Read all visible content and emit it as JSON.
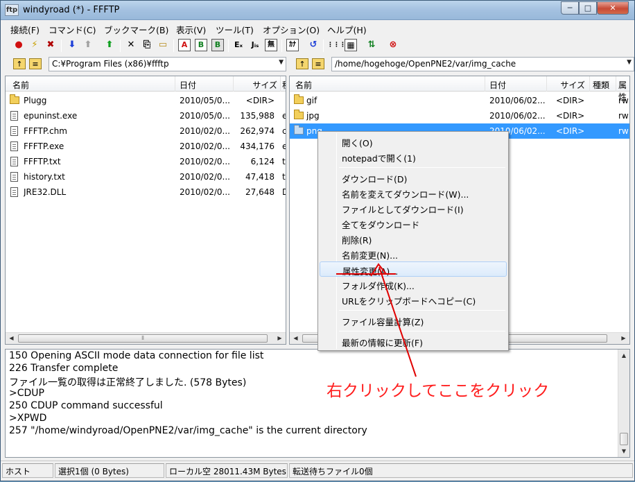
{
  "window": {
    "title": "windyroad (*) - FFFTP",
    "app_icon_label": "ftp",
    "min_label": "─",
    "max_label": "□",
    "close_label": "✕"
  },
  "menu": [
    "接続(F)",
    "コマンド(C)",
    "ブックマーク(B)",
    "表示(V)",
    "ツール(T)",
    "オプション(O)",
    "ヘルプ(H)"
  ],
  "toolbar": {
    "connect": "●",
    "quick_connect": "⚡",
    "disconnect": "✖",
    "download": "⬇",
    "upload": "⬆",
    "mirror_upload": "⬆",
    "delete": "✕",
    "rename": "⎘",
    "mkdir": "▭",
    "mode_ascii": "A",
    "mode_binary": "B",
    "mode_auto": "B",
    "kanji_euc": "Eₓ",
    "kanji_jis": "Jᵢₛ",
    "kanji_none": "無",
    "kana": "ｶﾅ",
    "refresh": "↺",
    "view_list": "⋮⋮⋮",
    "view_detail": "▦",
    "sync": "⇅",
    "stop": "⊗"
  },
  "local": {
    "path": "C:¥Program Files (x86)¥ffftp",
    "columns": [
      "名前",
      "日付",
      "サイズ",
      "種"
    ],
    "rows": [
      {
        "type": "folder",
        "name": "Plugg",
        "date": "2010/05/0...",
        "size": "<DIR>",
        "ext": ""
      },
      {
        "type": "file",
        "name": "epuninst.exe",
        "date": "2010/05/0...",
        "size": "135,988",
        "ext": "e"
      },
      {
        "type": "file",
        "name": "FFFTP.chm",
        "date": "2010/02/0...",
        "size": "262,974",
        "ext": "c"
      },
      {
        "type": "file",
        "name": "FFFTP.exe",
        "date": "2010/02/0...",
        "size": "434,176",
        "ext": "e"
      },
      {
        "type": "file",
        "name": "FFFTP.txt",
        "date": "2010/02/0...",
        "size": "6,124",
        "ext": "t"
      },
      {
        "type": "file",
        "name": "history.txt",
        "date": "2010/02/0...",
        "size": "47,418",
        "ext": "t"
      },
      {
        "type": "file",
        "name": "JRE32.DLL",
        "date": "2010/02/0...",
        "size": "27,648",
        "ext": "D"
      }
    ]
  },
  "remote": {
    "path": "/home/hogehoge/OpenPNE2/var/img_cache",
    "columns": [
      "名前",
      "日付",
      "サイズ",
      "種類",
      "属性"
    ],
    "rows": [
      {
        "type": "folder",
        "name": "gif",
        "date": "2010/06/02...",
        "size": "<DIR>",
        "kind": "",
        "attr": "rw"
      },
      {
        "type": "folder",
        "name": "jpg",
        "date": "2010/06/02...",
        "size": "<DIR>",
        "kind": "",
        "attr": "rw"
      },
      {
        "type": "folder",
        "name": "png",
        "date": "2010/06/02...",
        "size": "<DIR>",
        "kind": "",
        "attr": "rw",
        "selected": true
      }
    ]
  },
  "context_menu": {
    "items": [
      "開く(O)",
      "notepadで開く(1)",
      "ダウンロード(D)",
      "名前を変えてダウンロード(W)...",
      "ファイルとしてダウンロード(I)",
      "全てをダウンロード",
      "削除(R)",
      "名前変更(N)...",
      "属性変更(A)...",
      "フォルダ作成(K)...",
      "URLをクリップボードへコピー(C)",
      "ファイル容量計算(Z)",
      "最新の情報に更新(F)"
    ]
  },
  "log": [
    "150 Opening ASCII mode data connection for file list",
    "226 Transfer complete",
    "ファイル一覧の取得は正常終了しました. (578 Bytes)",
    ">CDUP",
    "250 CDUP command successful",
    ">XPWD",
    "257 \"/home/windyroad/OpenPNE2/var/img_cache\" is the current directory"
  ],
  "status": {
    "host": "ホスト",
    "selection": "選択1個 (0 Bytes)",
    "local_free": "ローカル空 28011.43M Bytes",
    "queue": "転送待ちファイル0個"
  },
  "annotation": {
    "text": "右クリックしてここをクリック",
    "color": "#ff1c1c"
  },
  "scroll": {
    "left": "◀",
    "right": "▶",
    "up": "▲",
    "down": "▼",
    "grip": "⦀"
  }
}
